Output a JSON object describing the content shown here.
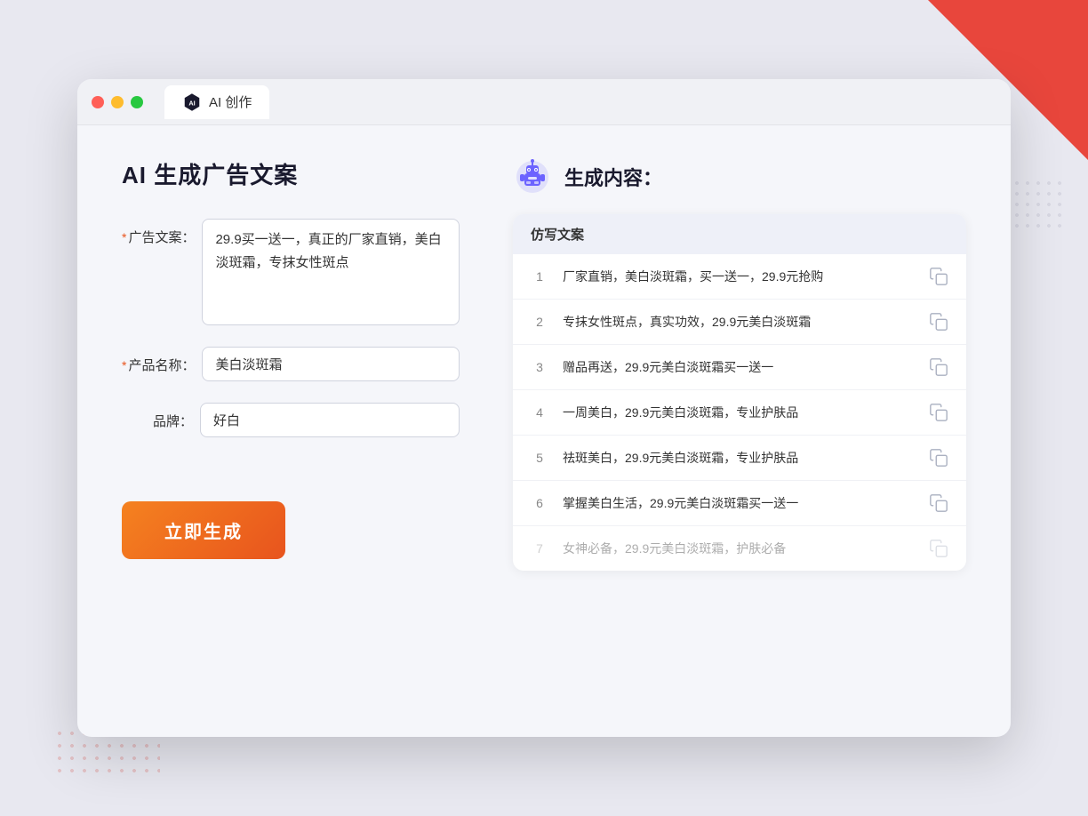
{
  "browser": {
    "tab_label": "AI 创作",
    "traffic_lights": [
      "red",
      "yellow",
      "green"
    ]
  },
  "page": {
    "title": "AI 生成广告文案",
    "form": {
      "ad_copy_label": "广告文案：",
      "ad_copy_required": "*",
      "ad_copy_value": "29.9买一送一，真正的厂家直销，美白淡斑霜，专抹女性斑点",
      "product_name_label": "产品名称：",
      "product_name_required": "*",
      "product_name_value": "美白淡斑霜",
      "brand_label": "品牌：",
      "brand_value": "好白",
      "generate_button": "立即生成"
    },
    "results": {
      "header_icon": "robot",
      "header_title": "生成内容：",
      "table_header": "仿写文案",
      "items": [
        {
          "number": "1",
          "text": "厂家直销，美白淡斑霜，买一送一，29.9元抢购",
          "faded": false
        },
        {
          "number": "2",
          "text": "专抹女性斑点，真实功效，29.9元美白淡斑霜",
          "faded": false
        },
        {
          "number": "3",
          "text": "赠品再送，29.9元美白淡斑霜买一送一",
          "faded": false
        },
        {
          "number": "4",
          "text": "一周美白，29.9元美白淡斑霜，专业护肤品",
          "faded": false
        },
        {
          "number": "5",
          "text": "祛斑美白，29.9元美白淡斑霜，专业护肤品",
          "faded": false
        },
        {
          "number": "6",
          "text": "掌握美白生活，29.9元美白淡斑霜买一送一",
          "faded": false
        },
        {
          "number": "7",
          "text": "女神必备，29.9元美白淡斑霜，护肤必备",
          "faded": true
        }
      ]
    }
  }
}
